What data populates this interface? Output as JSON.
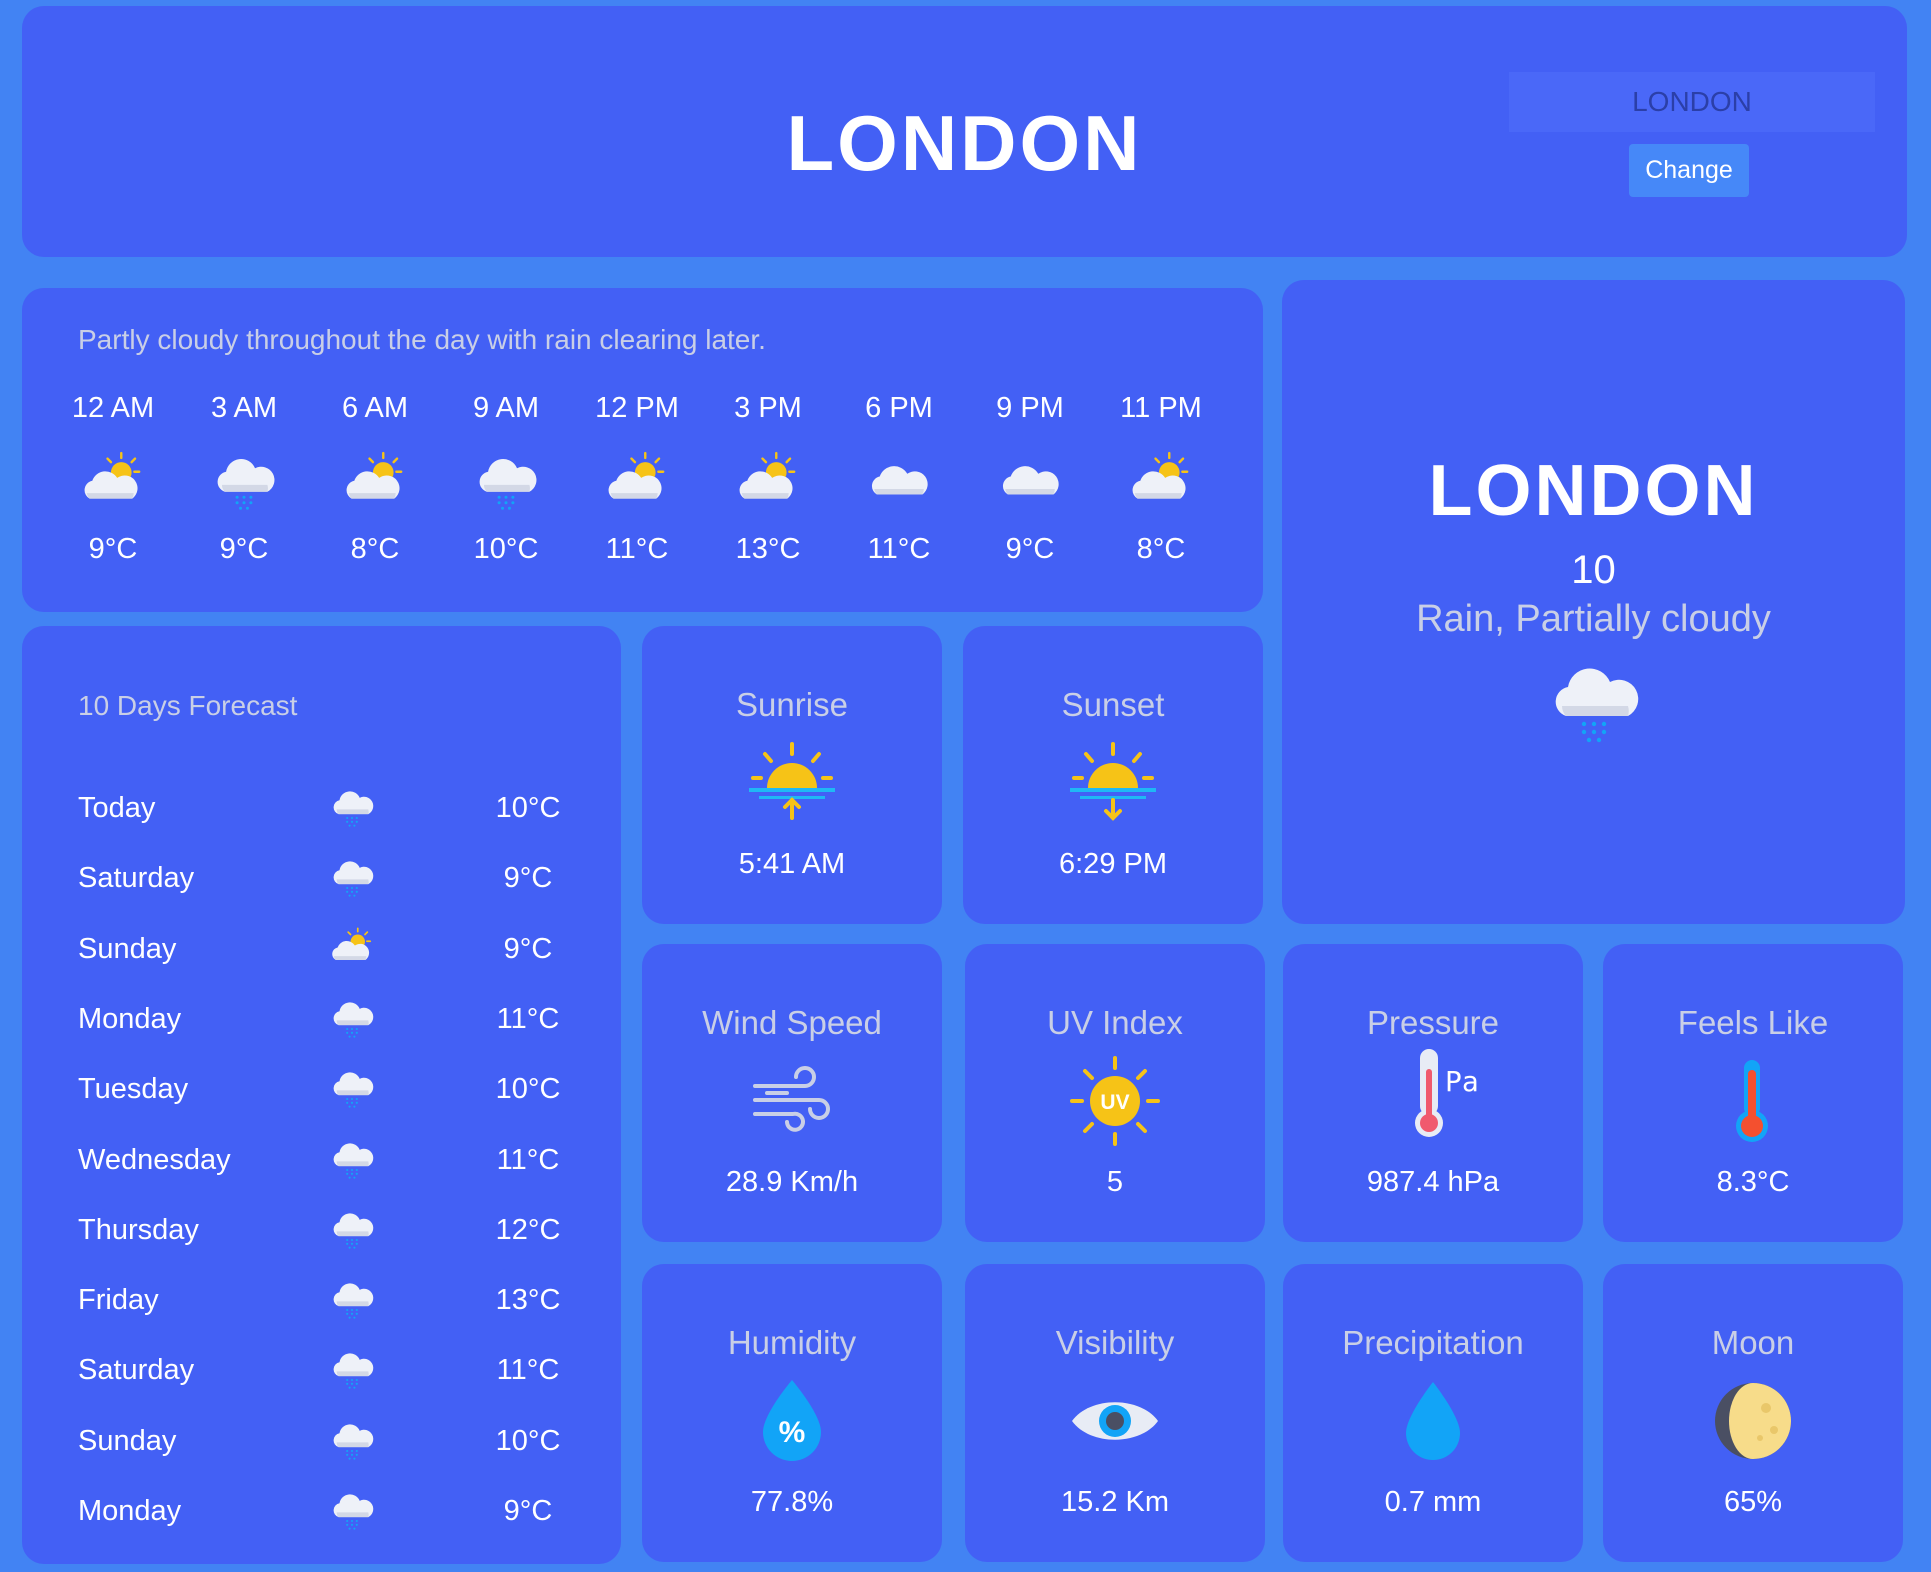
{
  "header": {
    "city": "LONDON",
    "input_placeholder": "LONDON",
    "change_label": "Change"
  },
  "hourly": {
    "description": "Partly cloudy throughout the day with rain clearing later.",
    "hours": [
      {
        "time": "12 AM",
        "icon": "partly-cloudy-day-icon",
        "temp": "9°C"
      },
      {
        "time": "3 AM",
        "icon": "rain-cloud-icon",
        "temp": "9°C"
      },
      {
        "time": "6 AM",
        "icon": "partly-cloudy-day-icon",
        "temp": "8°C"
      },
      {
        "time": "9 AM",
        "icon": "rain-cloud-icon",
        "temp": "10°C"
      },
      {
        "time": "12 PM",
        "icon": "partly-cloudy-day-icon",
        "temp": "11°C"
      },
      {
        "time": "3 PM",
        "icon": "partly-cloudy-day-icon",
        "temp": "13°C"
      },
      {
        "time": "6 PM",
        "icon": "cloud-icon",
        "temp": "11°C"
      },
      {
        "time": "9 PM",
        "icon": "cloud-icon",
        "temp": "9°C"
      },
      {
        "time": "11 PM",
        "icon": "partly-cloudy-day-icon",
        "temp": "8°C"
      }
    ]
  },
  "daily": {
    "title": "10 Days Forecast",
    "days": [
      {
        "day": "Today",
        "icon": "rain-cloud-icon",
        "temp": "10°C"
      },
      {
        "day": "Saturday",
        "icon": "rain-cloud-icon",
        "temp": "9°C"
      },
      {
        "day": "Sunday",
        "icon": "partly-cloudy-day-icon",
        "temp": "9°C"
      },
      {
        "day": "Monday",
        "icon": "rain-cloud-icon",
        "temp": "11°C"
      },
      {
        "day": "Tuesday",
        "icon": "rain-cloud-icon",
        "temp": "10°C"
      },
      {
        "day": "Wednesday",
        "icon": "rain-cloud-icon",
        "temp": "11°C"
      },
      {
        "day": "Thursday",
        "icon": "rain-cloud-icon",
        "temp": "12°C"
      },
      {
        "day": "Friday",
        "icon": "rain-cloud-icon",
        "temp": "13°C"
      },
      {
        "day": "Saturday",
        "icon": "rain-cloud-icon",
        "temp": "11°C"
      },
      {
        "day": "Sunday",
        "icon": "rain-cloud-icon",
        "temp": "10°C"
      },
      {
        "day": "Monday",
        "icon": "rain-cloud-icon",
        "temp": "9°C"
      }
    ]
  },
  "current": {
    "city": "LONDON",
    "temp": "10",
    "conditions": "Rain, Partially cloudy",
    "icon": "rain-cloud-icon"
  },
  "stats": {
    "sunrise": {
      "label": "Sunrise",
      "value": "5:41 AM",
      "icon": "sunrise-icon"
    },
    "sunset": {
      "label": "Sunset",
      "value": "6:29 PM",
      "icon": "sunset-icon"
    },
    "wind": {
      "label": "Wind Speed",
      "value": "28.9 Km/h",
      "icon": "wind-icon"
    },
    "uv": {
      "label": "UV Index",
      "value": "5",
      "icon": "uv-sun-icon",
      "badge": "UV"
    },
    "pressure": {
      "label": "Pressure",
      "value": "987.4 hPa",
      "icon": "thermometer-pa-icon",
      "badge": "Pa"
    },
    "feels": {
      "label": "Feels Like",
      "value": "8.3°C",
      "icon": "thermometer-icon"
    },
    "humidity": {
      "label": "Humidity",
      "value": "77.8%",
      "icon": "humidity-drop-icon",
      "badge": "%"
    },
    "visibility": {
      "label": "Visibility",
      "value": "15.2 Km",
      "icon": "eye-icon"
    },
    "precipitation": {
      "label": "Precipitation",
      "value": "0.7 mm",
      "icon": "water-drop-icon"
    },
    "moon": {
      "label": "Moon",
      "value": "65%",
      "icon": "moon-phase-icon"
    }
  },
  "colors": {
    "page_bg": "#4283f3",
    "card_bg": "#4360f5",
    "muted_text": "#c9cfe6",
    "sun_yellow": "#f6c317",
    "drop_blue": "#12a4f7"
  }
}
